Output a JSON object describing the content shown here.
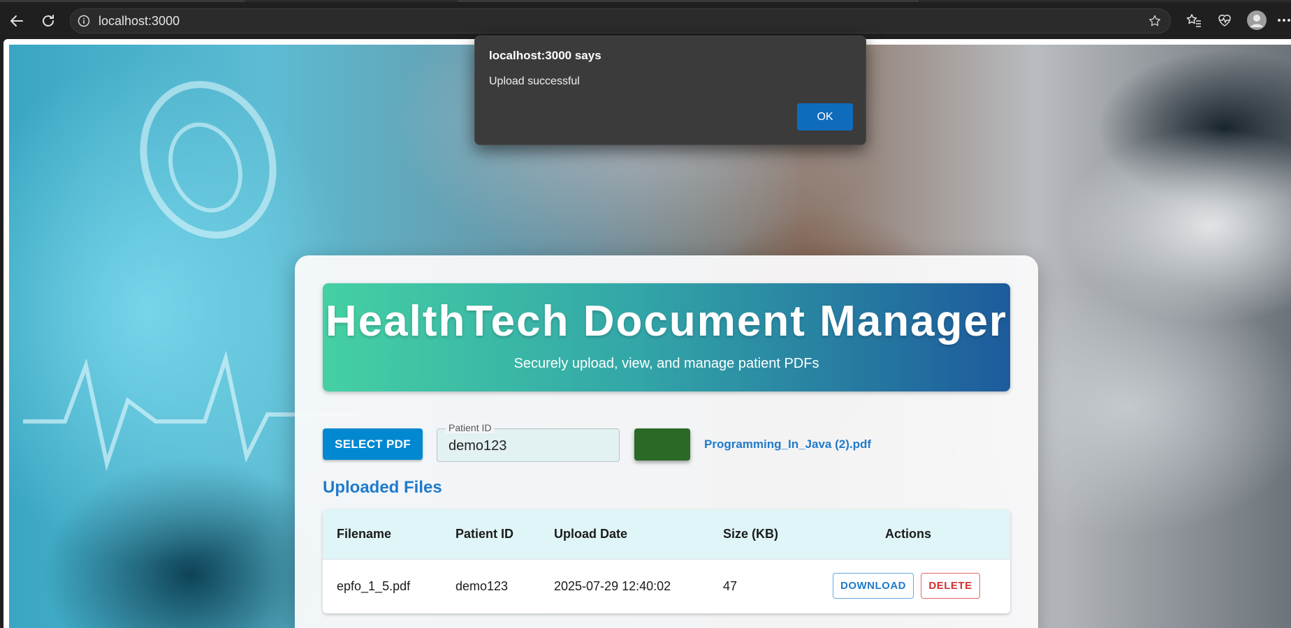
{
  "browser": {
    "url": "localhost:3000"
  },
  "app": {
    "title": "HealthTech Document Manager",
    "subtitle": "Securely upload, view, and manage patient PDFs",
    "select_pdf_label": "SELECT PDF",
    "patient_id_label": "Patient ID",
    "patient_id_value": "demo123",
    "selected_file": "Programming_In_Java (2).pdf",
    "uploaded_files_heading": "Uploaded Files",
    "table": {
      "headers": [
        "Filename",
        "Patient ID",
        "Upload Date",
        "Size (KB)",
        "Actions"
      ],
      "rows": [
        {
          "filename": "epfo_1_5.pdf",
          "patient_id": "demo123",
          "upload_date": "2025-07-29 12:40:02",
          "size_kb": "47",
          "download_label": "DOWNLOAD",
          "delete_label": "DELETE"
        }
      ]
    }
  },
  "dialog": {
    "title": "localhost:3000 says",
    "message": "Upload successful",
    "ok_label": "OK"
  },
  "colors": {
    "primary_blue": "#0288d1",
    "upload_green": "#2a6a26",
    "link_blue": "#1f7ac9",
    "delete_red": "#d32f2f"
  },
  "icons": [
    "back-arrow-icon",
    "refresh-icon",
    "info-icon",
    "star-icon",
    "favorites-icon",
    "health-icon",
    "profile-icon",
    "more-icon"
  ]
}
